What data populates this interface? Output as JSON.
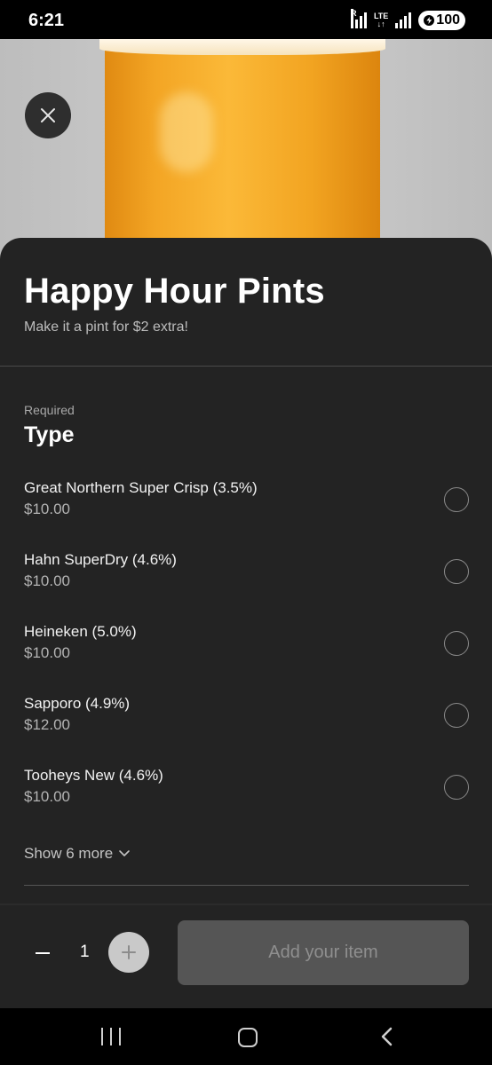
{
  "status_bar": {
    "time": "6:21",
    "signal_tag": "R",
    "network_label_top": "LTE",
    "network_label_bottom": "↓↑",
    "battery": "100"
  },
  "product": {
    "title": "Happy Hour Pints",
    "subtitle": "Make it a pint for $2 extra!"
  },
  "section": {
    "required_label": "Required",
    "title": "Type"
  },
  "options": [
    {
      "name": "Great Northern Super Crisp (3.5%)",
      "price": "$10.00"
    },
    {
      "name": "Hahn SuperDry (4.6%)",
      "price": "$10.00"
    },
    {
      "name": "Heineken (5.0%)",
      "price": "$10.00"
    },
    {
      "name": "Sapporo (4.9%)",
      "price": "$12.00"
    },
    {
      "name": "Tooheys New (4.6%)",
      "price": "$10.00"
    }
  ],
  "show_more_label": "Show 6 more",
  "footer": {
    "quantity": "1",
    "add_button_label": "Add your item"
  },
  "icons": {
    "close": "close-icon",
    "chevron": "chevron-down-icon",
    "plus": "plus-icon",
    "minus": "minus-icon"
  },
  "colors": {
    "sheet_bg": "#232323",
    "add_button_bg": "#555555",
    "add_button_text": "#8f8f8f"
  }
}
